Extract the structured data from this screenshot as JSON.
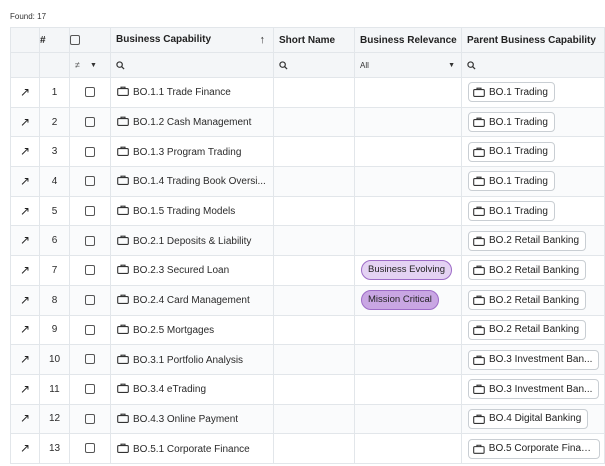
{
  "found_label": "Found: 17",
  "columns": {
    "num": "#",
    "capability": "Business Capability",
    "short_name": "Short Name",
    "relevance": "Business Relevance",
    "parent": "Parent Business Capability"
  },
  "filters": {
    "relevance_value": "All"
  },
  "colors": {
    "relevance_evolving": "#e4d2f3",
    "relevance_critical": "#c9a6e3",
    "pill_border": "#9d6bc7"
  },
  "rows": [
    {
      "num": "1",
      "capability": "BO.1.1 Trade Finance",
      "short_name": "",
      "relevance": "",
      "parent": "BO.1 Trading"
    },
    {
      "num": "2",
      "capability": "BO.1.2 Cash Management",
      "short_name": "",
      "relevance": "",
      "parent": "BO.1 Trading"
    },
    {
      "num": "3",
      "capability": "BO.1.3 Program Trading",
      "short_name": "",
      "relevance": "",
      "parent": "BO.1 Trading"
    },
    {
      "num": "4",
      "capability": "BO.1.4 Trading Book Oversi...",
      "short_name": "",
      "relevance": "",
      "parent": "BO.1 Trading"
    },
    {
      "num": "5",
      "capability": "BO.1.5 Trading Models",
      "short_name": "",
      "relevance": "",
      "parent": "BO.1 Trading"
    },
    {
      "num": "6",
      "capability": "BO.2.1 Deposits & Liability",
      "short_name": "",
      "relevance": "",
      "parent": "BO.2 Retail Banking"
    },
    {
      "num": "7",
      "capability": "BO.2.3 Secured Loan",
      "short_name": "",
      "relevance": "Business Evolving",
      "parent": "BO.2 Retail Banking"
    },
    {
      "num": "8",
      "capability": "BO.2.4 Card Management",
      "short_name": "",
      "relevance": "Mission Critical",
      "parent": "BO.2 Retail Banking"
    },
    {
      "num": "9",
      "capability": "BO.2.5 Mortgages",
      "short_name": "",
      "relevance": "",
      "parent": "BO.2 Retail Banking"
    },
    {
      "num": "10",
      "capability": "BO.3.1 Portfolio Analysis",
      "short_name": "",
      "relevance": "",
      "parent": "BO.3 Investment Ban..."
    },
    {
      "num": "11",
      "capability": "BO.3.4 eTrading",
      "short_name": "",
      "relevance": "",
      "parent": "BO.3 Investment Ban..."
    },
    {
      "num": "12",
      "capability": "BO.4.3 Online Payment",
      "short_name": "",
      "relevance": "",
      "parent": "BO.4 Digital Banking"
    },
    {
      "num": "13",
      "capability": "BO.5.1 Corporate Finance",
      "short_name": "",
      "relevance": "",
      "parent": "BO.5 Corporate Finan..."
    }
  ]
}
